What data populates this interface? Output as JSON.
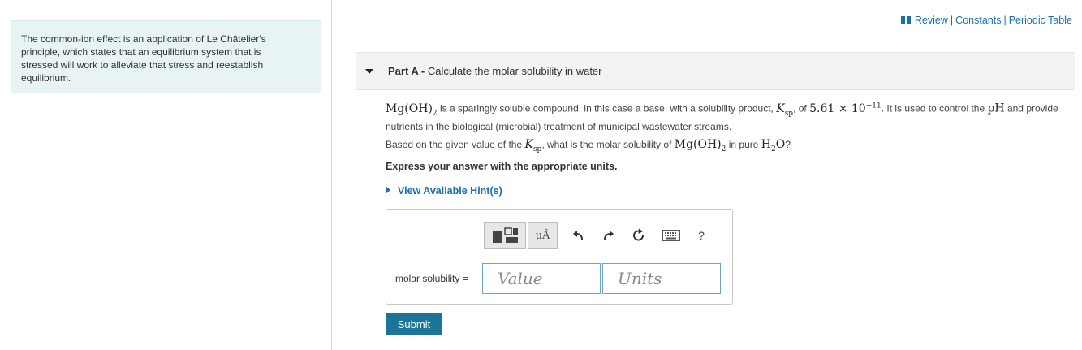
{
  "intro": {
    "text": "The common-ion effect is an application of Le Châtelier's principle, which states that an equilibrium system that is stressed will work to alleviate that stress and reestablish equilibrium."
  },
  "toplinks": {
    "review": "Review",
    "separator": "|",
    "constants": "Constants",
    "periodic_table": "Periodic Table"
  },
  "part": {
    "label": "Part A -",
    "title": "Calculate the molar solubility in water"
  },
  "statement": {
    "compound": "Mg(OH)",
    "compound_sub": "2",
    "text_1": " is a sparingly soluble compound, in this case a base, with a solubility product, ",
    "ksp_k": "K",
    "ksp_sub": "sp",
    "text_2": ", of ",
    "ksp_value": "5.61 × 10",
    "ksp_exp": "−11",
    "text_3": ". It is used to control the ",
    "ph": "pH",
    "text_4": " and provide nutrients in the biological (microbial) treatment of municipal wastewater streams."
  },
  "question": {
    "text_1": "Based on the given value of the ",
    "ksp_k": "K",
    "ksp_sub": "sp",
    "text_2": ", what is the molar solubility of ",
    "compound": "Mg(OH)",
    "compound_sub": "2",
    "text_3": " in pure ",
    "water_h": "H",
    "water_sub": "2",
    "water_o": "O",
    "text_4": "?"
  },
  "instruction": "Express your answer with the appropriate units.",
  "hints": {
    "label": "View Available Hint(s)"
  },
  "toolbar": {
    "units_symbol": "μÅ",
    "help": "?",
    "icons": [
      "templates-icon",
      "units-icon",
      "undo-icon",
      "redo-icon",
      "reset-icon",
      "keyboard-icon",
      "help-icon"
    ]
  },
  "answer": {
    "label": "molar solubility =",
    "value_placeholder": "Value",
    "units_placeholder": "Units"
  },
  "submit": {
    "label": "Submit"
  },
  "colors": {
    "link": "#1a6fb3",
    "intro_bg": "#e7f3f5",
    "submit_bg": "#1b7599",
    "field_border": "#6aa6c7"
  }
}
